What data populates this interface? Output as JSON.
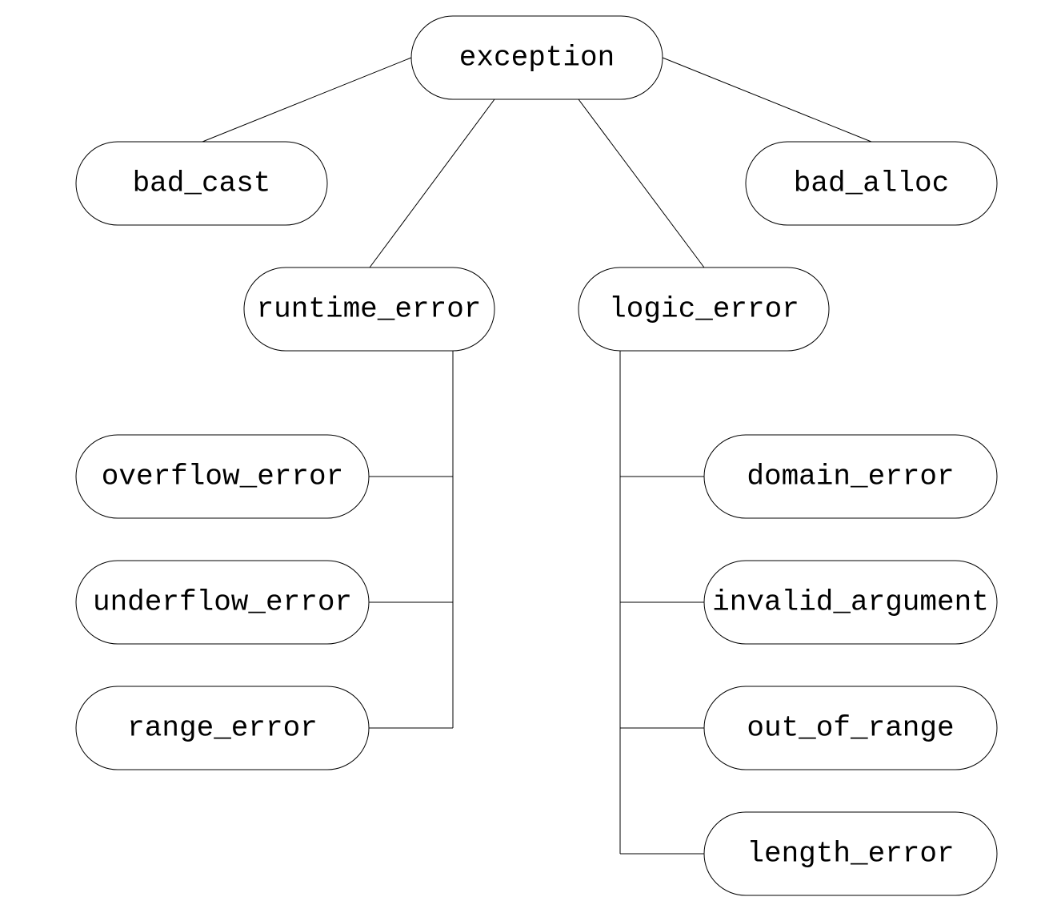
{
  "nodes": {
    "exception": "exception",
    "bad_cast": "bad_cast",
    "bad_alloc": "bad_alloc",
    "runtime_error": "runtime_error",
    "logic_error": "logic_error",
    "overflow_error": "overflow_error",
    "underflow_error": "underflow_error",
    "range_error": "range_error",
    "domain_error": "domain_error",
    "invalid_argument": "invalid_argument",
    "out_of_range": "out_of_range",
    "length_error": "length_error"
  }
}
